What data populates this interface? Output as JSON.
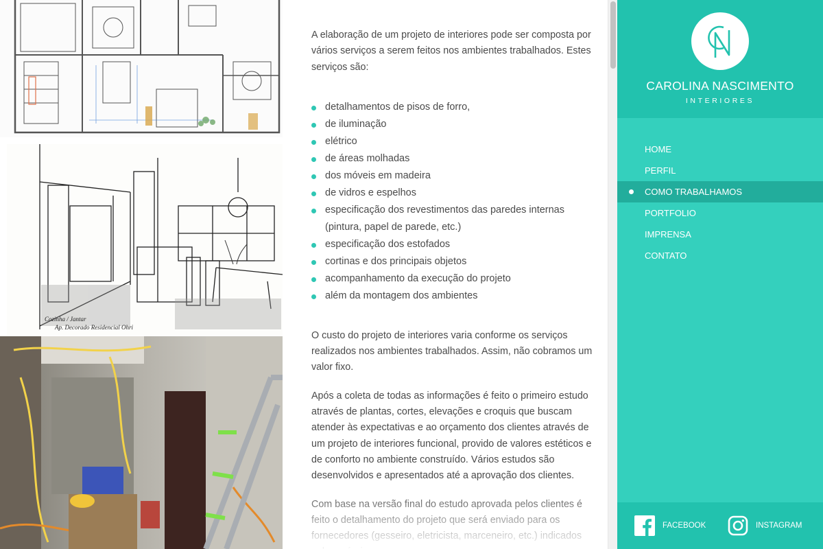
{
  "content": {
    "intro": "A elaboração de um projeto de interiores pode ser composta por vários serviços a serem feitos nos ambientes trabalhados. Estes serviços são:",
    "services": [
      "detalhamentos de pisos de forro,",
      "de iluminação",
      "elétrico",
      "de áreas molhadas",
      "dos móveis em madeira",
      "de vidros e espelhos",
      "especificação dos revestimentos das paredes internas (pintura, papel de parede, etc.)",
      "especificação dos estofados",
      "cortinas e dos principais objetos",
      "acompanhamento da execução do projeto",
      "além da montagem dos ambientes"
    ],
    "cost": "O custo do projeto de interiores varia conforme os serviços realizados nos ambientes trabalhados. Assim, não cobramos um valor fixo.",
    "process": "Após a coleta de todas as informações é feito o primeiro estudo através de plantas, cortes, elevações e croquis que buscam atender às expectativas e ao orçamento dos clientes através de um projeto de interiores funcional, provido de valores estéticos e de conforto no ambiente construído. Vários estudos são desenvolvidos e apresentados até a aprovação dos clientes.",
    "final": "Com base na versão final do estudo aprovada pelos clientes é feito o detalhamento do projeto que será enviado para os fornecedores (gesseiro, eletricista, marceneiro, etc.) indicados pelos próprios"
  },
  "sidebar": {
    "logo_letters": "CN",
    "brand_name": "CAROLINA NASCIMENTO",
    "brand_sub": "INTERIORES",
    "nav": [
      {
        "label": "HOME",
        "active": false
      },
      {
        "label": "PERFIL",
        "active": false
      },
      {
        "label": "COMO TRABALHAMOS",
        "active": true
      },
      {
        "label": "PORTFOLIO",
        "active": false
      },
      {
        "label": "IMPRENSA",
        "active": false
      },
      {
        "label": "CONTATO",
        "active": false
      }
    ],
    "social": {
      "facebook_label": "FACEBOOK",
      "instagram_label": "INSTAGRAM"
    }
  },
  "sketch_caption": "Cozinha / Jantar  Ap. Decorado Residencial Ohri",
  "colors": {
    "accent": "#34d0bd",
    "accent_dark": "#22c2ae",
    "active": "#22ad9c",
    "bullet": "#2fc7b4"
  }
}
